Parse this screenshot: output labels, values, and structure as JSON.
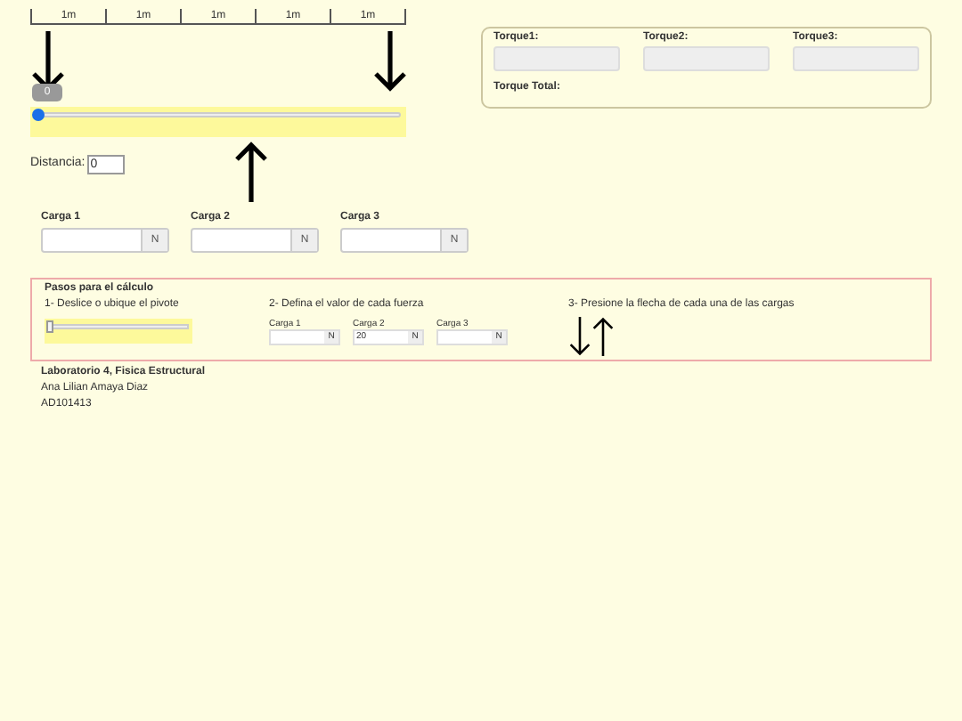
{
  "ruler": {
    "segments": [
      "1m",
      "1m",
      "1m",
      "1m",
      "1m"
    ]
  },
  "beam_arrows": [
    {
      "kind": "down"
    },
    {
      "kind": "down"
    },
    {
      "kind": "up"
    }
  ],
  "pivot_slider": {
    "tooltip": "0",
    "level": 0
  },
  "distance": {
    "label": "Distancia:",
    "value": "0"
  },
  "torques": [
    {
      "label": "Torque1:"
    },
    {
      "label": "Torque2:"
    },
    {
      "label": "Torque3:"
    }
  ],
  "torque_total": {
    "label": "Torque Total:"
  },
  "loads": [
    {
      "label": "Carga 1",
      "unit": "N"
    },
    {
      "label": "Carga 2",
      "unit": "N"
    },
    {
      "label": "Carga 3",
      "unit": "N"
    }
  ],
  "steps": {
    "title": "Pasos para el cálculo",
    "step1": {
      "text": "1- Deslice o ubique el pivote",
      "level": 0
    },
    "step2": {
      "text": "2- Defina el valor de cada fuerza",
      "loads": [
        {
          "label": "Carga 1",
          "unit": "N"
        },
        {
          "label": "Carga 2",
          "value": "20",
          "unit": "N"
        },
        {
          "label": "Carga 3",
          "unit": "N"
        }
      ]
    },
    "step3": {
      "text": "3- Presione la flecha de cada una de las cargas",
      "arrows": [
        {
          "kind": "down"
        },
        {
          "kind": "up"
        }
      ]
    }
  },
  "footer": [
    "Laboratorio 4, Fisica Estructural",
    "Ana Lilian Amaya Diaz",
    "AD101413"
  ]
}
